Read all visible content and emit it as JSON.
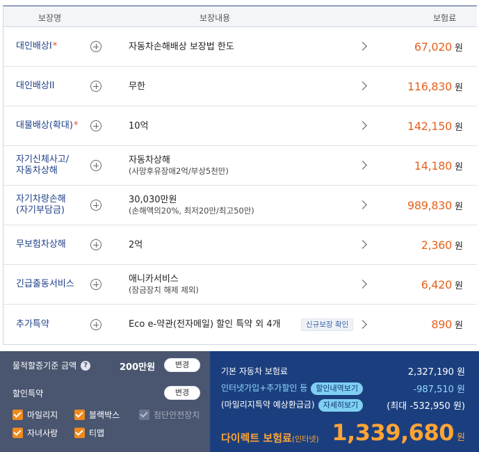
{
  "table": {
    "headers": {
      "name": "보장명",
      "content": "보장내용",
      "premium": "보험료"
    },
    "currency": "원",
    "rows": [
      {
        "name": "대인배상I",
        "required": true,
        "content": "자동차손해배상 보장법 한도",
        "sub": "",
        "tag": "",
        "premium": "67,020"
      },
      {
        "name": "대인배상II",
        "required": false,
        "content": "무한",
        "sub": "",
        "tag": "",
        "premium": "116,830"
      },
      {
        "name": "대물배상(확대)",
        "required": true,
        "content": "10억",
        "sub": "",
        "tag": "",
        "premium": "142,150"
      },
      {
        "name": "자기신체사고/\n자동차상해",
        "required": false,
        "content": "자동차상해",
        "sub": "(사망후유장애2억/부상5천만)",
        "tag": "",
        "premium": "14,180"
      },
      {
        "name": "자기차량손해\n(자기부담금)",
        "required": false,
        "content": "30,030만원",
        "sub": "(손해액의20%, 최저20만/최고50만)",
        "tag": "",
        "premium": "989,830"
      },
      {
        "name": "무보험차상해",
        "required": false,
        "content": "2억",
        "sub": "",
        "tag": "",
        "premium": "2,360"
      },
      {
        "name": "긴급출동서비스",
        "required": false,
        "content": "애니카서비스",
        "sub": "(잠금장치 해제 제외)",
        "tag": "",
        "premium": "6,420"
      },
      {
        "name": "추가특약",
        "required": false,
        "content": "Eco e-약관(전자메일) 할인 특약 외 4개",
        "sub": "",
        "tag": "신규보장 확인",
        "premium": "890"
      }
    ],
    "required_mark": "*"
  },
  "left_panel": {
    "property_label": "물적할증기준 금액",
    "property_value": "200만원",
    "change_label": "변경",
    "discount_label": "할인특약",
    "checkboxes": [
      {
        "label": "마일리지",
        "checked": true,
        "disabled": false
      },
      {
        "label": "블랙박스",
        "checked": true,
        "disabled": false
      },
      {
        "label": "첨단안전장치",
        "checked": true,
        "disabled": true
      },
      {
        "label": "자녀사랑",
        "checked": true,
        "disabled": false
      },
      {
        "label": "티맵",
        "checked": true,
        "disabled": false
      }
    ]
  },
  "right_panel": {
    "base_label": "기본 자동차 보험료",
    "base_value": "2,327,190 원",
    "discount_label": "인터넷가입+추가할인 등",
    "discount_pill": "할인내역보기",
    "discount_value": "-987,510 원",
    "mileage_label": "(마일리지특약 예상환급금)",
    "mileage_pill": "자세히보기",
    "mileage_value": "(최대 -532,950 원)",
    "total_label": "다이렉트 보험료",
    "total_suffix": "(인터넷)",
    "total_value": "1,339,680",
    "total_unit": "원"
  },
  "colors": {
    "accent_orange": "#e8601c",
    "navy": "#1b3f7e",
    "slate": "#4a5670",
    "checkbox_orange": "#f08a1d",
    "pill_cyan": "#7fd0f3"
  }
}
